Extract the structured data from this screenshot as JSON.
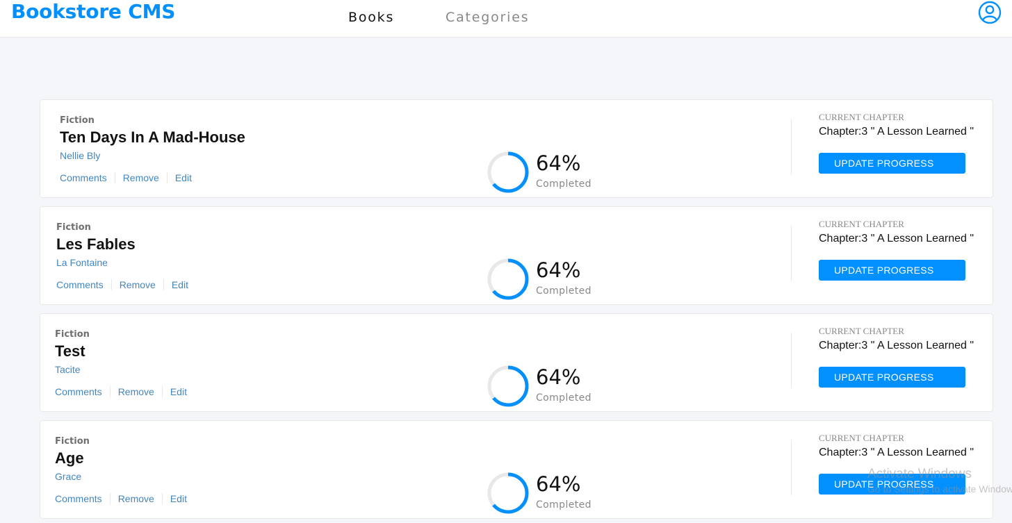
{
  "header": {
    "brand": "Bookstore CMS",
    "nav": [
      {
        "label": "Books"
      },
      {
        "label": "Categories"
      }
    ],
    "user_icon": "user-circle-icon"
  },
  "colors": {
    "accent": "#0290ff",
    "link": "#4386bf",
    "ring_track": "#e8e8e8"
  },
  "books": [
    {
      "genre": "Fiction",
      "title": "Ten Days In A Mad-House",
      "author": "Nellie Bly",
      "actions": [
        "Comments",
        "Remove",
        "Edit"
      ],
      "progress_percent": 64,
      "progress_label": "64%",
      "completed_label": "Completed",
      "current_chapter_label": "CURRENT CHAPTER",
      "chapter": "Chapter:3 \" A Lesson Learned \"",
      "update_button": "UPDATE PROGRESS"
    },
    {
      "genre": "Fiction",
      "title": "Les Fables",
      "author": "La Fontaine",
      "actions": [
        "Comments",
        "Remove",
        "Edit"
      ],
      "progress_percent": 64,
      "progress_label": "64%",
      "completed_label": "Completed",
      "current_chapter_label": "CURRENT CHAPTER",
      "chapter": "Chapter:3 \" A Lesson Learned \"",
      "update_button": "UPDATE PROGRESS"
    },
    {
      "genre": "Fiction",
      "title": "Test",
      "author": "Tacite",
      "actions": [
        "Comments",
        "Remove",
        "Edit"
      ],
      "progress_percent": 64,
      "progress_label": "64%",
      "completed_label": "Completed",
      "current_chapter_label": "CURRENT CHAPTER",
      "chapter": "Chapter:3 \" A Lesson Learned \"",
      "update_button": "UPDATE PROGRESS"
    },
    {
      "genre": "Fiction",
      "title": "Age",
      "author": "Grace",
      "actions": [
        "Comments",
        "Remove",
        "Edit"
      ],
      "progress_percent": 64,
      "progress_label": "64%",
      "completed_label": "Completed",
      "current_chapter_label": "CURRENT CHAPTER",
      "chapter": "Chapter:3 \" A Lesson Learned \"",
      "update_button": "UPDATE PROGRESS"
    }
  ],
  "watermark": {
    "title": "Activate Windows",
    "subtitle": "Go to Settings to activate Windows."
  }
}
